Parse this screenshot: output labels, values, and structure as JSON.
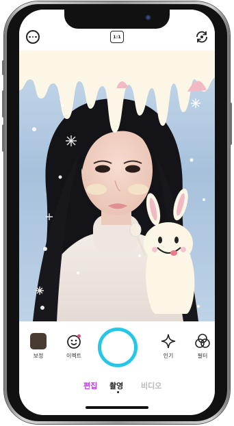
{
  "top_bar": {
    "ratio_label": "1:1"
  },
  "tools": [
    {
      "icon": "beauty-swatch-icon",
      "label": "보정"
    },
    {
      "icon": "smile-effect-icon",
      "label": "이펙트"
    },
    {
      "icon": "sparkle-icon",
      "label": "인기"
    },
    {
      "icon": "filter-circles-icon",
      "label": "필터"
    }
  ],
  "modes": [
    {
      "label": "편집",
      "color": "#b543e0",
      "active": false
    },
    {
      "label": "촬영",
      "color": "#222222",
      "active": true
    },
    {
      "label": "비디오",
      "color": "#b9b9b9",
      "active": false
    }
  ],
  "colors": {
    "shutter_ring": "#26c6e6",
    "edit_purple": "#b543e0",
    "beauty_swatch": "#4a3b32"
  }
}
